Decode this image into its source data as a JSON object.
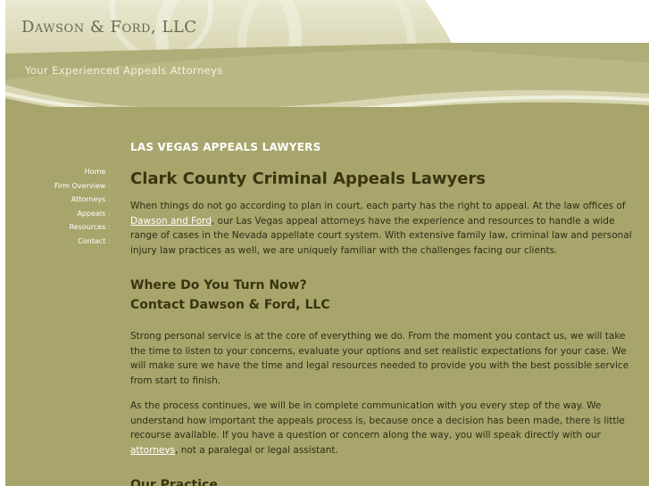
{
  "header": {
    "firm_name": "Dawson & Ford, LLC",
    "tagline": "Your Experienced Appeals Attorneys"
  },
  "nav": {
    "items": [
      "Home",
      "Firm Overview",
      "Attorneys",
      "Appeals",
      "Resources",
      "Contact"
    ],
    "separator": ":"
  },
  "main": {
    "kicker": "LAS VEGAS APPEALS LAWYERS",
    "title": "Clark County Criminal Appeals Lawyers",
    "p1_before": "When things do not go according to plan in court, each party has the right to appeal. At the law offices of ",
    "p1_link": "Dawson and Ford",
    "p1_after": ", our Las Vegas appeal attorneys have the experience and resources to handle a wide range of cases in the Nevada appellate court system. With extensive family law, criminal law and personal injury law practices as well, we are uniquely familiar with the challenges facing our clients.",
    "h2_line1": "Where Do You Turn Now?",
    "h2_line2": "Contact Dawson & Ford, LLC",
    "p2": "Strong personal service is at the core of everything we do. From the moment you contact us, we will take the time to listen to your concerns, evaluate your options and set realistic expectations for your case. We will make sure we have the time and legal resources needed to provide you with the best possible service from start to finish.",
    "p3_before": "As the process continues, we will be in complete communication with you every step of the way. We understand how important the appeals process is, because once a decision has been made, there is little recourse available. If you have a question or concern along the way, you will speak directly with our ",
    "p3_link": "attorneys",
    "p3_after": ", not a paralegal or legal assistant.",
    "h2_practice": "Our Practice"
  }
}
